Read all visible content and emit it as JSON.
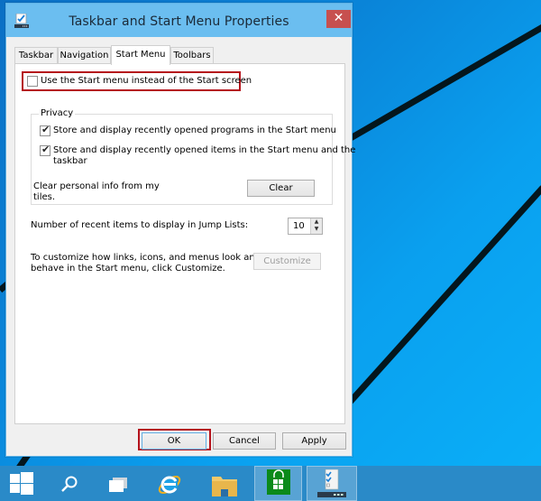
{
  "window": {
    "title": "Taskbar and Start Menu Properties",
    "close_glyph": "✕"
  },
  "tabs": [
    {
      "label": "Taskbar",
      "active": false
    },
    {
      "label": "Navigation",
      "active": false
    },
    {
      "label": "Start Menu",
      "active": true
    },
    {
      "label": "Toolbars",
      "active": false
    }
  ],
  "start_menu": {
    "use_start_menu": {
      "label": "Use the Start menu instead of the Start screen",
      "checked": false
    },
    "privacy": {
      "title": "Privacy",
      "store_programs": {
        "label": "Store and display recently opened programs in the Start menu",
        "checked": true
      },
      "store_items": {
        "label_line1": "Store and display recently opened items in the Start menu and the",
        "label_line2": "taskbar",
        "checked": true
      },
      "clear_info_line1": "Clear personal info from my",
      "clear_info_line2": "tiles.",
      "clear_button": "Clear"
    },
    "jump_lists": {
      "label": "Number of recent items to display in Jump Lists:",
      "value": "10"
    },
    "customize": {
      "text_line1": "To customize how links, icons, and menus look and",
      "text_line2": "behave in the Start menu, click Customize.",
      "button": "Customize",
      "enabled": false
    }
  },
  "footer": {
    "ok": "OK",
    "cancel": "Cancel",
    "apply": "Apply"
  },
  "highlight_color": "#b5121b",
  "taskbar": {
    "items": [
      "start-button",
      "search",
      "task-view",
      "internet-explorer",
      "file-explorer",
      "store",
      "taskbar-properties"
    ]
  },
  "check_glyph": "✔",
  "spin_up": "▲",
  "spin_down": "▼"
}
